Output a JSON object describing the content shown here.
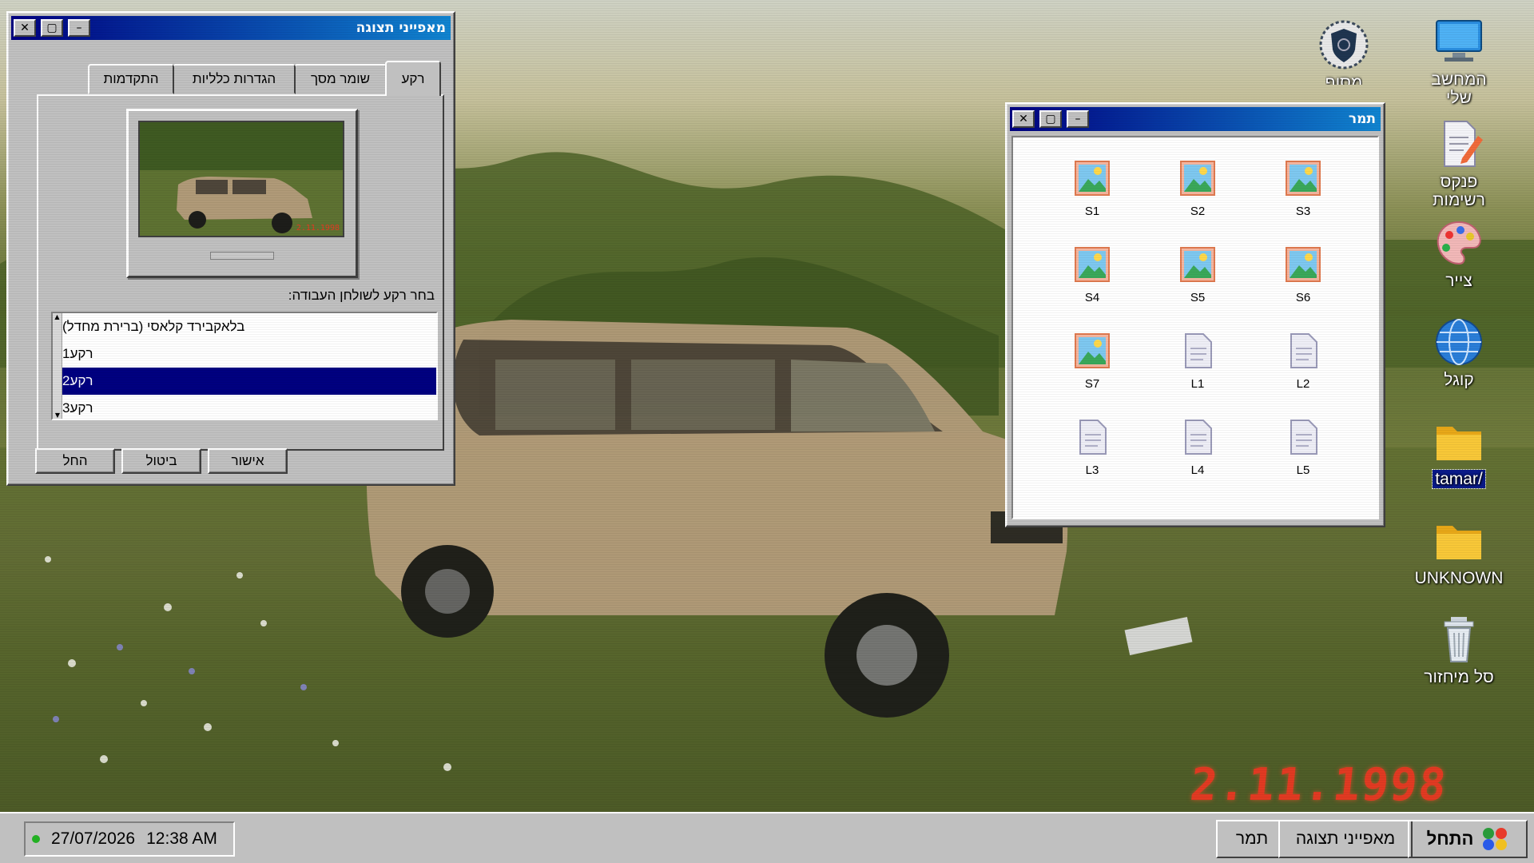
{
  "wallpaper": {
    "date_stamp": "2.11.1998"
  },
  "desktop_icons": [
    {
      "label": "המחשב שלי",
      "icon": "computer-icon"
    },
    {
      "label": "מסוף",
      "icon": "shield-icon"
    },
    {
      "label": "פנקס רשימות",
      "icon": "notepad-icon"
    },
    {
      "label": "צייר",
      "icon": "palette-icon"
    },
    {
      "label": "קוגל",
      "icon": "globe-icon"
    },
    {
      "label": "/tamar",
      "icon": "folder-icon",
      "selected": true
    },
    {
      "label": "UNKNOWN",
      "icon": "folder-icon"
    },
    {
      "label": "סל מיחזור",
      "icon": "recycle-bin-icon"
    }
  ],
  "display_window": {
    "title": "מאפייני תצוגה",
    "tabs": [
      "רקע",
      "שומר מסך",
      "הגדרות כלליות",
      "התקדמות"
    ],
    "active_tab": "רקע",
    "prompt": "בחר רקע לשולחן העבודה:",
    "wallpapers": [
      "בלאקבירד קלאסי (ברירת מחדל)",
      "רקע1",
      "רקע2",
      "רקע3"
    ],
    "selected_wallpaper": "רקע2",
    "buttons": {
      "ok": "אישור",
      "cancel": "ביטול",
      "apply": "החל"
    },
    "preview_stamp": "2.11.1998"
  },
  "folder_window": {
    "title": "תמר",
    "files": [
      {
        "name": "S3",
        "type": "image"
      },
      {
        "name": "S2",
        "type": "image"
      },
      {
        "name": "S1",
        "type": "image"
      },
      {
        "name": "S6",
        "type": "image"
      },
      {
        "name": "S5",
        "type": "image"
      },
      {
        "name": "S4",
        "type": "image"
      },
      {
        "name": "L2",
        "type": "document"
      },
      {
        "name": "L1",
        "type": "document"
      },
      {
        "name": "S7",
        "type": "image"
      },
      {
        "name": "L5",
        "type": "document"
      },
      {
        "name": "L4",
        "type": "document"
      },
      {
        "name": "L3",
        "type": "document"
      }
    ]
  },
  "window_controls": {
    "close": "✕",
    "maximize": "▢",
    "minimize": "–"
  },
  "taskbar": {
    "start_label": "התחל",
    "tasks": [
      "מאפייני תצוגה",
      "תמר"
    ],
    "date": "27/07/2026",
    "time": "12:38 AM"
  },
  "colors": {
    "title_bar": "#000080",
    "selection": "#000080",
    "face": "#c0c0c0",
    "date_stamp": "#e23a22"
  }
}
